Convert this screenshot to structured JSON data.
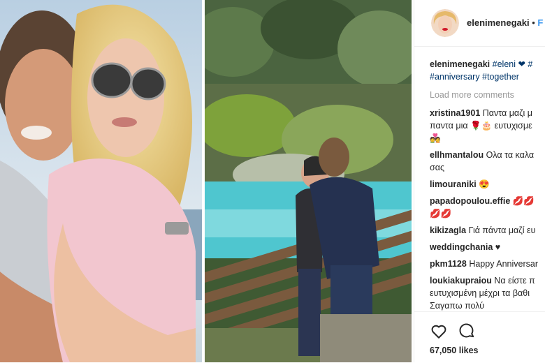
{
  "header": {
    "username": "elenimenegaki",
    "separator": "•",
    "follow_label": "F"
  },
  "comments": {
    "caption": {
      "user": "elenimenegaki",
      "line1_tags": "#eleni ❤ #",
      "line2_tags": "#anniversary #together"
    },
    "load_more": "Load more comments",
    "items": [
      {
        "user": "xristina1901",
        "line1": "Παντα μαζι μ",
        "line2": "παντα μια 🌹🎂 ευτυχισμε",
        "line3": "💑"
      },
      {
        "user": "ellhmantalou",
        "line1": "Ολα τα καλα",
        "line2": "σας"
      },
      {
        "user": "limouraniki",
        "line1": "😍"
      },
      {
        "user": "papadopoulou.effie",
        "line1": "💋💋",
        "line2": "💋💋"
      },
      {
        "user": "kikizagla",
        "line1": "Γιά πάντα μαζί ευ"
      },
      {
        "user": "weddingchania",
        "line1": "♥"
      },
      {
        "user": "pkm1128",
        "line1": "Happy Anniversar"
      },
      {
        "user": "loukiakupraiou",
        "line1": "Να είστε π",
        "line2": "ευτυχισμένη μέχρι τα βαθι",
        "line3": "Σαγαπω πολύ"
      }
    ]
  },
  "actions": {
    "like_icon": "heart-icon",
    "comment_icon": "comment-icon",
    "likes": "67,050 likes"
  },
  "colors": {
    "username": "#262626",
    "hashtag": "#003569",
    "muted": "#999999",
    "border": "#efefef"
  }
}
